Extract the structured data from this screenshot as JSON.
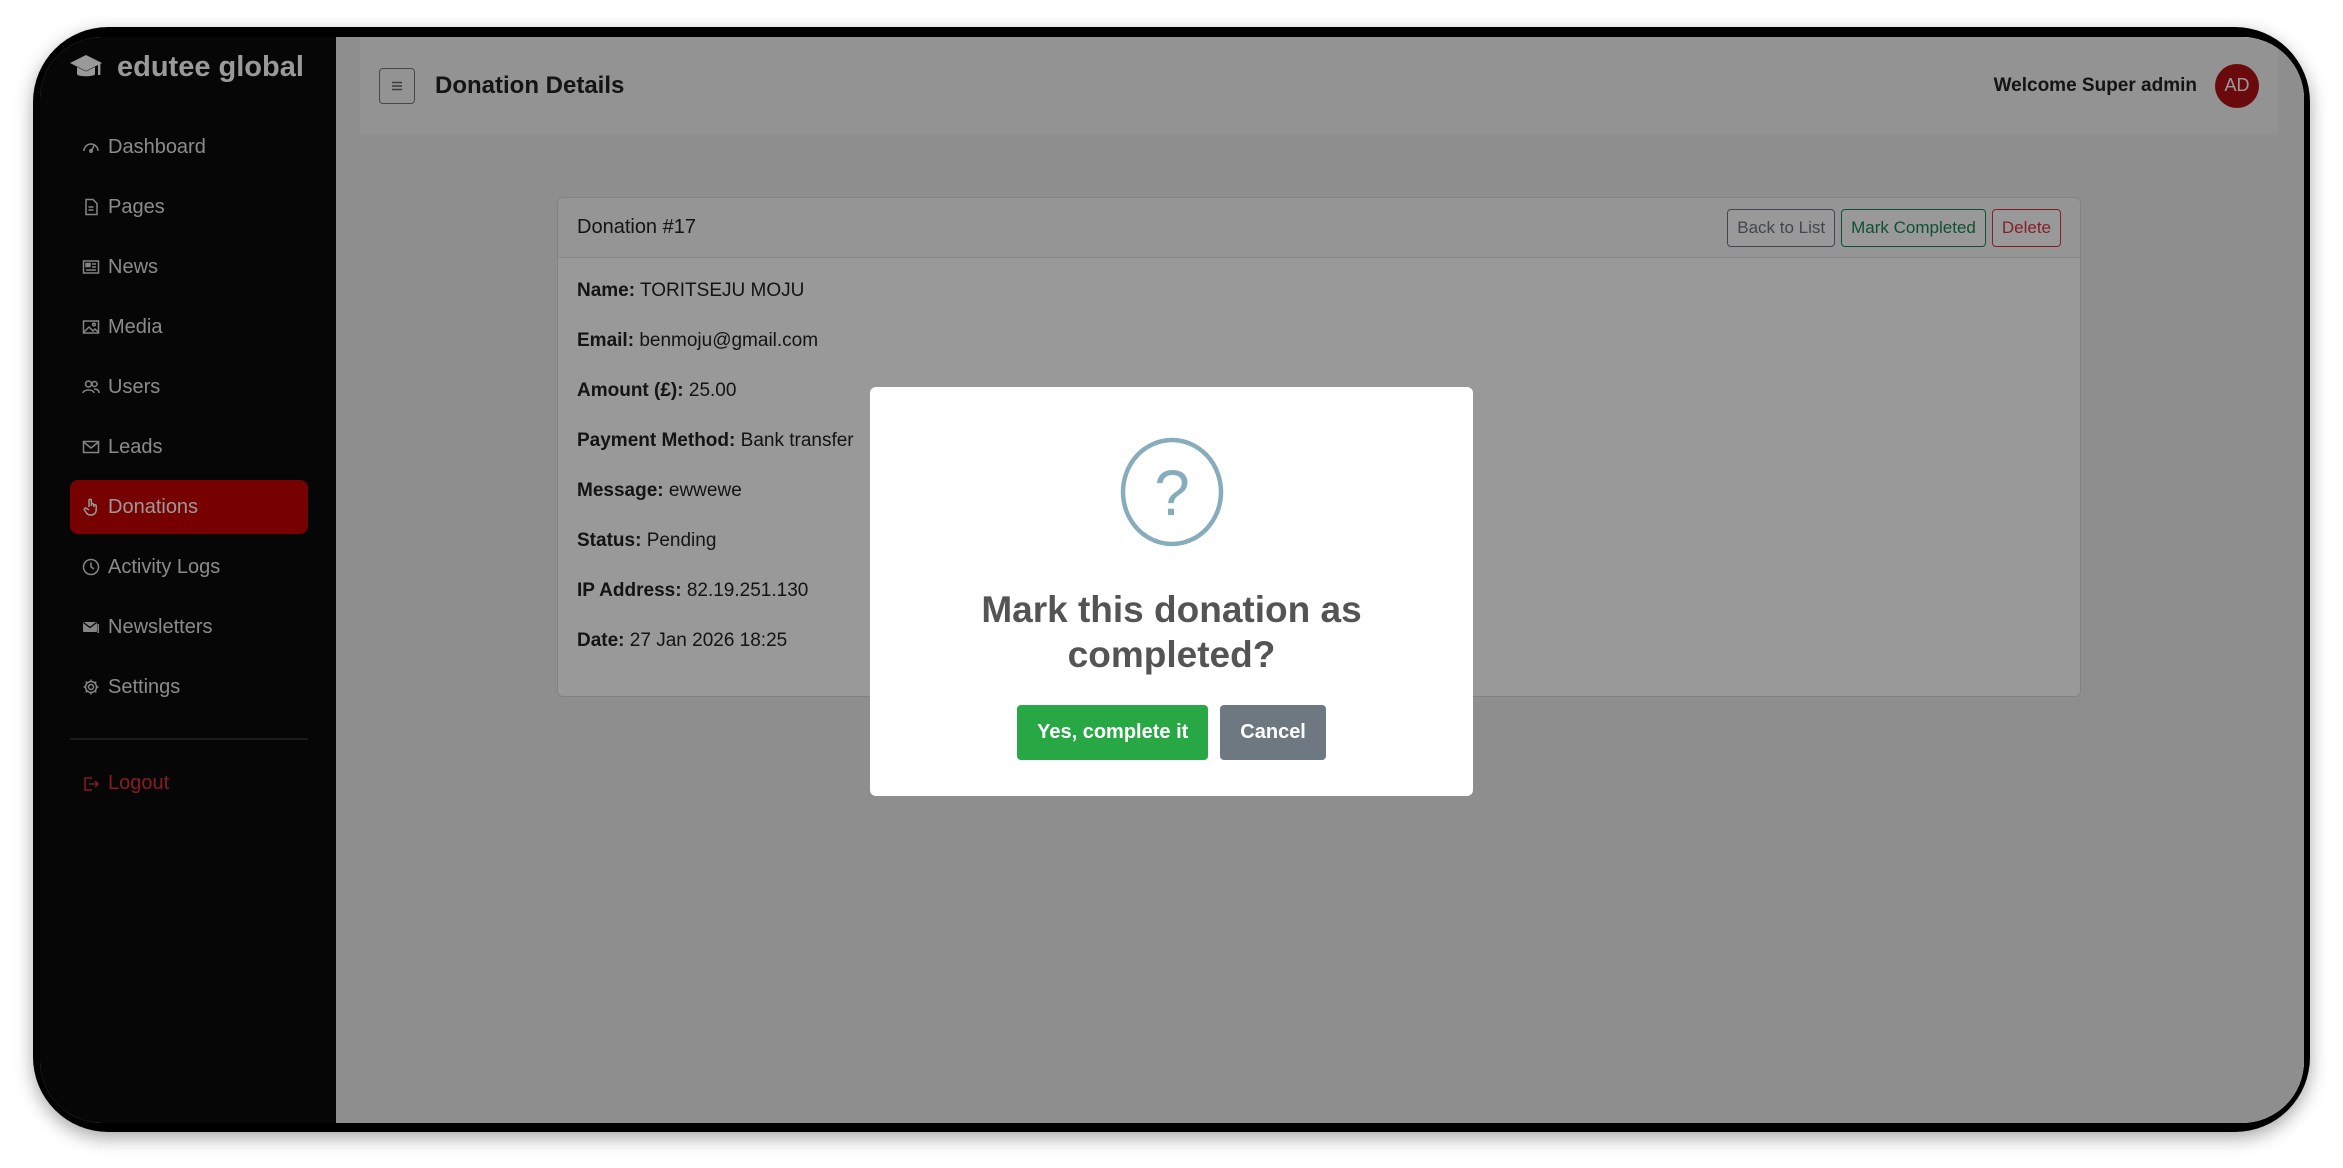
{
  "brand": {
    "name": "edutee global"
  },
  "sidebar": {
    "items": [
      {
        "label": "Dashboard",
        "icon": "gauge-icon"
      },
      {
        "label": "Pages",
        "icon": "file-icon"
      },
      {
        "label": "News",
        "icon": "newspaper-icon"
      },
      {
        "label": "Media",
        "icon": "image-icon"
      },
      {
        "label": "Users",
        "icon": "users-icon"
      },
      {
        "label": "Leads",
        "icon": "envelope-icon"
      },
      {
        "label": "Donations",
        "icon": "hand-icon",
        "active": true
      },
      {
        "label": "Activity Logs",
        "icon": "clock-icon"
      },
      {
        "label": "Newsletters",
        "icon": "mail-stack-icon"
      },
      {
        "label": "Settings",
        "icon": "gear-icon"
      }
    ],
    "logout_label": "Logout"
  },
  "header": {
    "title": "Donation Details",
    "welcome": "Welcome Super admin",
    "avatar_initials": "AD"
  },
  "card": {
    "title": "Donation #17",
    "actions": {
      "back": "Back to List",
      "complete": "Mark Completed",
      "delete": "Delete"
    },
    "fields": [
      {
        "label": "Name:",
        "value": "TORITSEJU MOJU"
      },
      {
        "label": "Email:",
        "value": "benmoju@gmail.com"
      },
      {
        "label": "Amount (£):",
        "value": "25.00"
      },
      {
        "label": "Payment Method:",
        "value": "Bank transfer"
      },
      {
        "label": "Message:",
        "value": "ewwewe"
      },
      {
        "label": "Status:",
        "value": "Pending"
      },
      {
        "label": "IP Address:",
        "value": "82.19.251.130"
      },
      {
        "label": "Date:",
        "value": "27 Jan 2026 18:25"
      }
    ]
  },
  "modal": {
    "icon": "question-icon",
    "title": "Mark this donation as completed?",
    "confirm_label": "Yes, complete it",
    "cancel_label": "Cancel"
  },
  "colors": {
    "sidebar_bg": "#0b0b0b",
    "active_item": "#c70000",
    "logout": "#e0303a",
    "confirm": "#28a745",
    "cancel": "#6e7881",
    "avatar": "#b31217"
  }
}
